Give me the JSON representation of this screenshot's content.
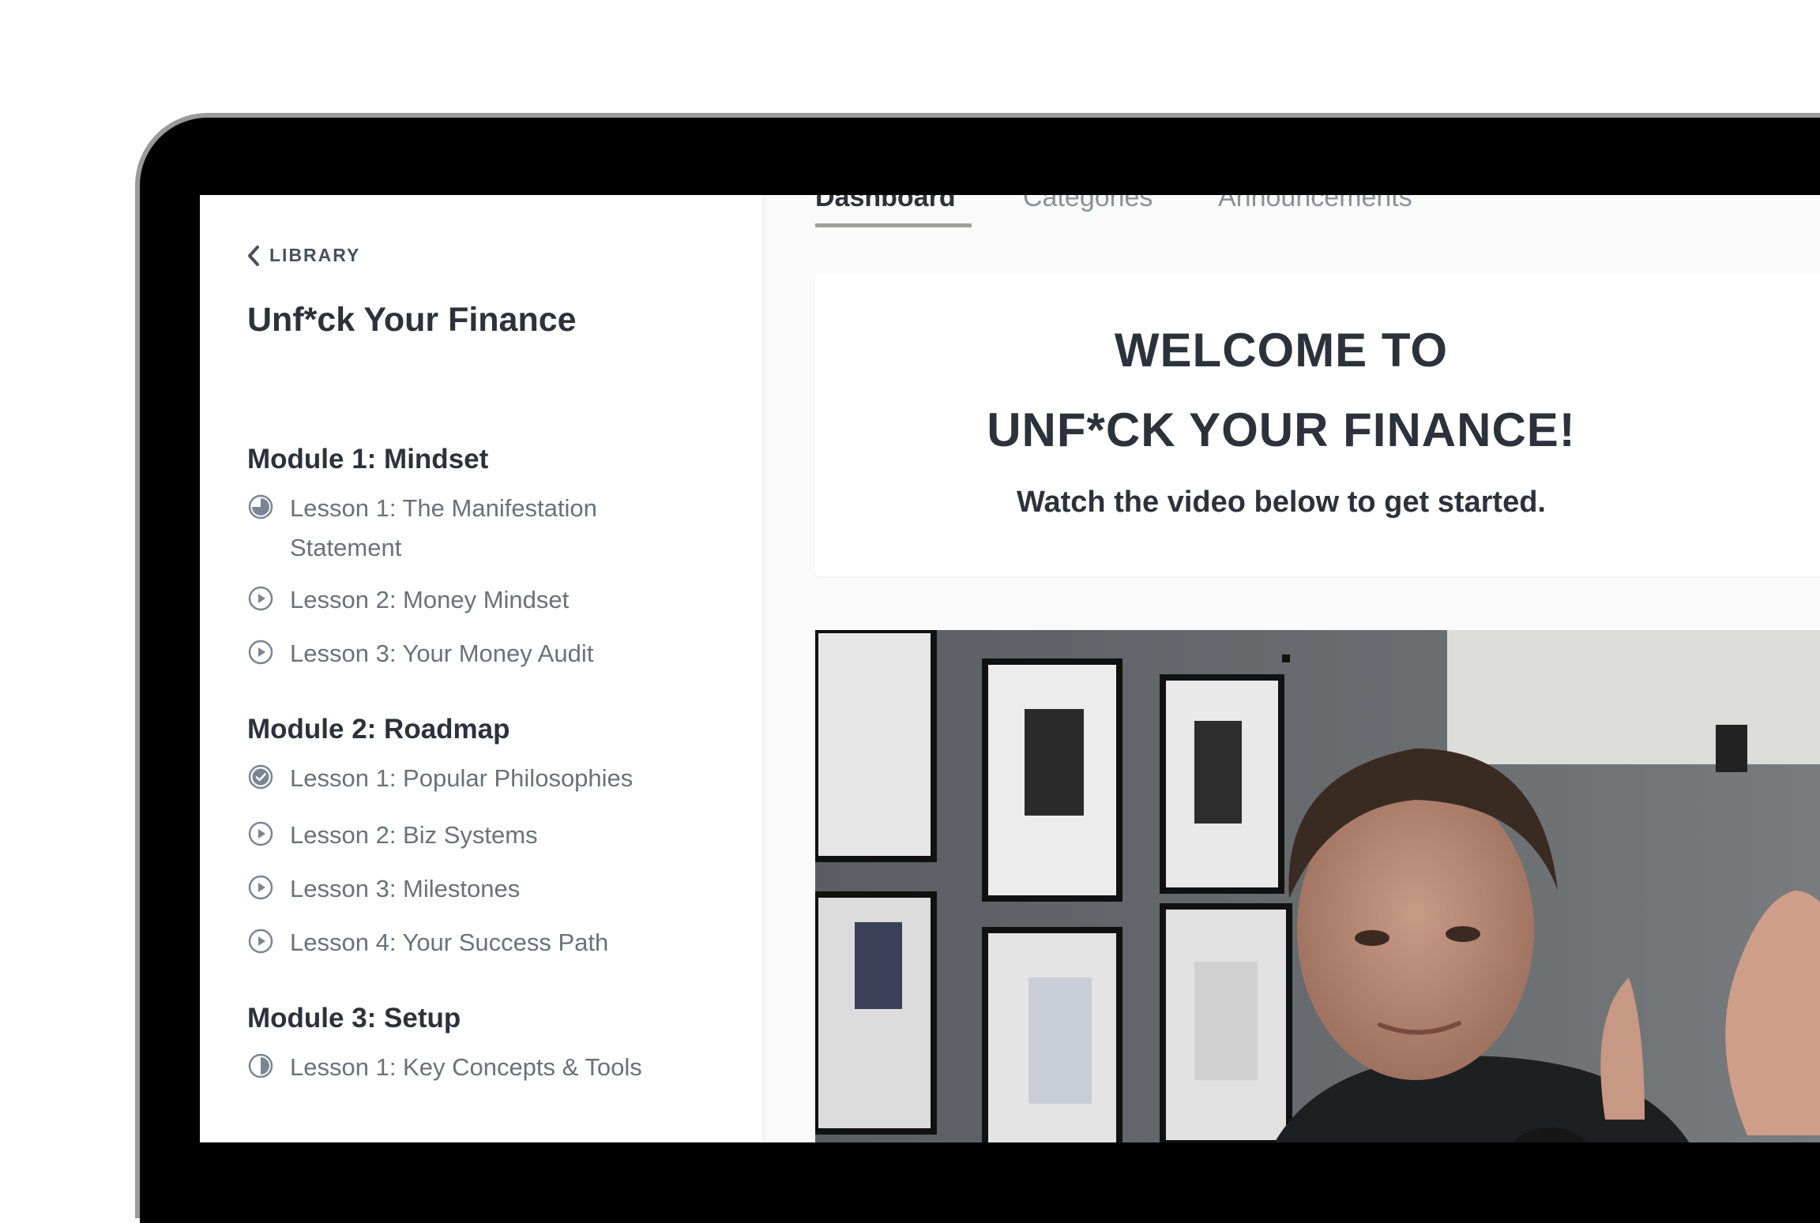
{
  "sidebar": {
    "back_label": "LIBRARY",
    "course_title": "Unf*ck Your Finance",
    "modules": [
      {
        "title": "Module 1: Mindset",
        "lessons": [
          {
            "label": "Lesson 1: The Manifestation Statement",
            "status": "in-progress"
          },
          {
            "label": "Lesson 2: Money Mindset",
            "status": "not-started"
          },
          {
            "label": "Lesson 3: Your Money Audit",
            "status": "not-started"
          }
        ]
      },
      {
        "title": "Module 2: Roadmap",
        "lessons": [
          {
            "label": "Lesson 1: Popular Philosophies",
            "status": "completed"
          },
          {
            "label": "Lesson 2: Biz Systems",
            "status": "not-started"
          },
          {
            "label": "Lesson 3: Milestones",
            "status": "not-started"
          },
          {
            "label": "Lesson 4: Your Success Path",
            "status": "not-started"
          }
        ]
      },
      {
        "title": "Module 3: Setup",
        "lessons": [
          {
            "label": "Lesson 1: Key Concepts & Tools",
            "status": "in-progress"
          }
        ]
      }
    ]
  },
  "tabs": [
    {
      "label": "Dashboard",
      "active": true
    },
    {
      "label": "Categories",
      "active": false
    },
    {
      "label": "Announcements",
      "active": false
    }
  ],
  "welcome": {
    "line1": "WELCOME TO",
    "line2": "UNF*CK YOUR FINANCE!",
    "subtitle": "Watch the video below to get started."
  },
  "colors": {
    "text_dark": "#2b323b",
    "text_muted": "#6b717a",
    "icon": "#7a8594",
    "tab_underline": "#a49e9e"
  }
}
